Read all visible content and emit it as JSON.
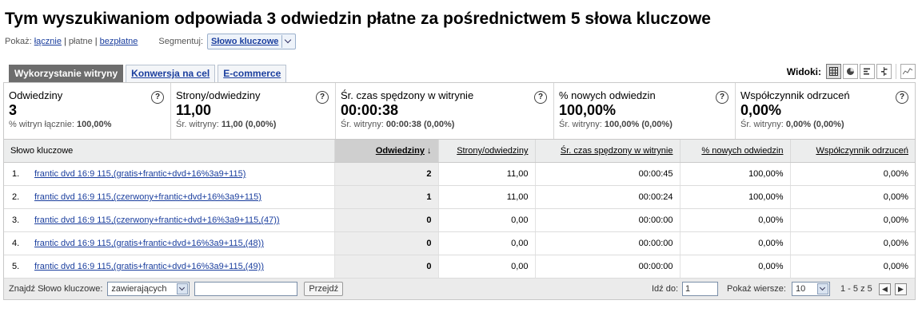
{
  "header": {
    "title": "Tym wyszukiwaniom odpowiada 3 odwiedzin płatne za pośrednictwem 5 słowa kluczowe",
    "show_label": "Pokaż:",
    "filter_all": "łącznie",
    "filter_paid": "płatne",
    "filter_free": "bezpłatne",
    "segment_label": "Segmentuj:",
    "segment_value": "Słowo kluczowe"
  },
  "tabs": [
    {
      "label": "Wykorzystanie witryny",
      "active": true
    },
    {
      "label": "Konwersja na cel",
      "active": false
    },
    {
      "label": "E-commerce",
      "active": false
    }
  ],
  "views": {
    "label": "Widoki:",
    "icons": [
      "table-view-icon",
      "pie-view-icon",
      "bar-view-icon",
      "compare-view-icon",
      "pivot-chart-icon"
    ]
  },
  "metrics": [
    {
      "label": "Odwiedziny",
      "value": "3",
      "sub_label": "% witryn łącznie:",
      "sub_value": "100,00%"
    },
    {
      "label": "Strony/odwiedziny",
      "value": "11,00",
      "sub_label": "Śr. witryny:",
      "sub_value": "11,00 (0,00%)"
    },
    {
      "label": "Śr. czas spędzony w witrynie",
      "value": "00:00:38",
      "sub_label": "Śr. witryny:",
      "sub_value": "00:00:38 (0,00%)"
    },
    {
      "label": "% nowych odwiedzin",
      "value": "100,00%",
      "sub_label": "Śr. witryny:",
      "sub_value": "100,00% (0,00%)"
    },
    {
      "label": "Współczynnik odrzuceń",
      "value": "0,00%",
      "sub_label": "Śr. witryny:",
      "sub_value": "0,00% (0,00%)"
    }
  ],
  "table": {
    "columns": [
      "Słowo kluczowe",
      "Odwiedziny",
      "Strony/odwiedziny",
      "Śr. czas spędzony w witrynie",
      "% nowych odwiedzin",
      "Współczynnik odrzuceń"
    ],
    "rows": [
      {
        "n": "1.",
        "keyword": "frantic dvd 16:9 115,(gratis+frantic+dvd+16%3a9+115)",
        "visits": "2",
        "pages": "11,00",
        "time": "00:00:45",
        "new": "100,00%",
        "bounce": "0,00%"
      },
      {
        "n": "2.",
        "keyword": "frantic dvd 16:9 115,(czerwony+frantic+dvd+16%3a9+115)",
        "visits": "1",
        "pages": "11,00",
        "time": "00:00:24",
        "new": "100,00%",
        "bounce": "0,00%"
      },
      {
        "n": "3.",
        "keyword": "frantic dvd 16:9 115,(czerwony+frantic+dvd+16%3a9+115,(47))",
        "visits": "0",
        "pages": "0,00",
        "time": "00:00:00",
        "new": "0,00%",
        "bounce": "0,00%"
      },
      {
        "n": "4.",
        "keyword": "frantic dvd 16:9 115,(gratis+frantic+dvd+16%3a9+115,(48))",
        "visits": "0",
        "pages": "0,00",
        "time": "00:00:00",
        "new": "0,00%",
        "bounce": "0,00%"
      },
      {
        "n": "5.",
        "keyword": "frantic dvd 16:9 115,(gratis+frantic+dvd+16%3a9+115,(49))",
        "visits": "0",
        "pages": "0,00",
        "time": "00:00:00",
        "new": "0,00%",
        "bounce": "0,00%"
      }
    ]
  },
  "footer": {
    "find_label": "Znajdź Słowo kluczowe:",
    "match_value": "zawierających",
    "search_value": "",
    "go_label": "Przejdź",
    "goto_label": "Idź do:",
    "goto_value": "1",
    "rows_label": "Pokaż wiersze:",
    "rows_value": "10",
    "range_text": "1 - 5 z 5"
  }
}
